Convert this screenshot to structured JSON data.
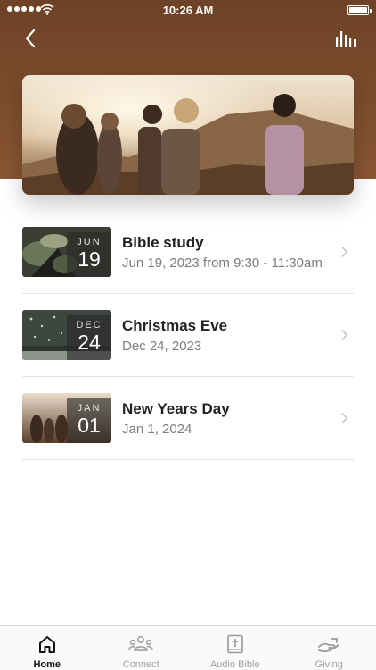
{
  "status_bar": {
    "time": "10:26 AM"
  },
  "header": {
    "back_icon": "chevron-left-icon",
    "audio_icon": "audio-bars-icon"
  },
  "events": [
    {
      "month": "JUN",
      "day": "19",
      "title": "Bible study",
      "date": "Jun 19, 2023 from 9:30 - 11:30am"
    },
    {
      "month": "DEC",
      "day": "24",
      "title": "Christmas Eve",
      "date": "Dec 24, 2023"
    },
    {
      "month": "JAN",
      "day": "01",
      "title": "New Years Day",
      "date": "Jan 1, 2024"
    }
  ],
  "tab_bar": {
    "active": "Home",
    "tabs": [
      {
        "label": "Home",
        "icon": "home-icon"
      },
      {
        "label": "Connect",
        "icon": "people-icon"
      },
      {
        "label": "Audio Bible",
        "icon": "bible-icon"
      },
      {
        "label": "Giving",
        "icon": "giving-hand-icon"
      }
    ]
  },
  "colors": {
    "header_brown": "#7a4a2c",
    "text_dark": "#222222",
    "text_muted": "#7d7d7d"
  }
}
